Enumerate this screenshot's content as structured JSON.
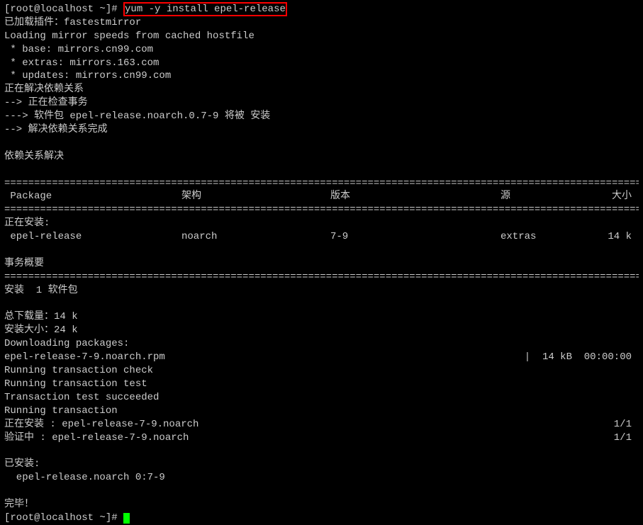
{
  "prompt": "[root@localhost ~]# ",
  "command": "yum -y install epel-release",
  "lines": {
    "plugins": "已加载插件：fastestmirror",
    "loading": "Loading mirror speeds from cached hostfile",
    "mirror_base": " * base: mirrors.cn99.com",
    "mirror_extras": " * extras: mirrors.163.com",
    "mirror_updates": " * updates: mirrors.cn99.com",
    "resolving": "正在解决依赖关系",
    "checking": "--> 正在检查事务",
    "pkg_will_install": "---> 软件包 epel-release.noarch.0.7-9 将被 安装",
    "dep_done": "--> 解决依赖关系完成",
    "dep_resolved": "依赖关系解决",
    "installing_header": "正在安装:",
    "transaction_summary": "事务概要",
    "install_count": "安装  1 软件包",
    "total_download": "总下载量：14 k",
    "install_size": "安装大小：24 k",
    "downloading": "Downloading packages:",
    "rpm_file": "epel-release-7-9.noarch.rpm",
    "download_progress": "|  14 kB  00:00:00",
    "trans_check": "Running transaction check",
    "trans_test": "Running transaction test",
    "trans_succeeded": "Transaction test succeeded",
    "running_trans": "Running transaction",
    "installing_pkg": "  正在安装    : epel-release-7-9.noarch",
    "verifying_pkg": "  验证中      : epel-release-7-9.noarch",
    "fraction": "1/1",
    "installed_header": "已安装:",
    "installed_pkg": "  epel-release.noarch 0:7-9",
    "complete": "完毕！",
    "prompt_end": "[root@localhost ~]# "
  },
  "table": {
    "headers": {
      "package": " Package",
      "arch": "架构",
      "version": "版本",
      "repo": "源",
      "size": "大小"
    },
    "row": {
      "package": " epel-release",
      "arch": "noarch",
      "version": "7-9",
      "repo": "extras",
      "size": "14 k"
    }
  },
  "divider": "=================================================================================================================================="
}
